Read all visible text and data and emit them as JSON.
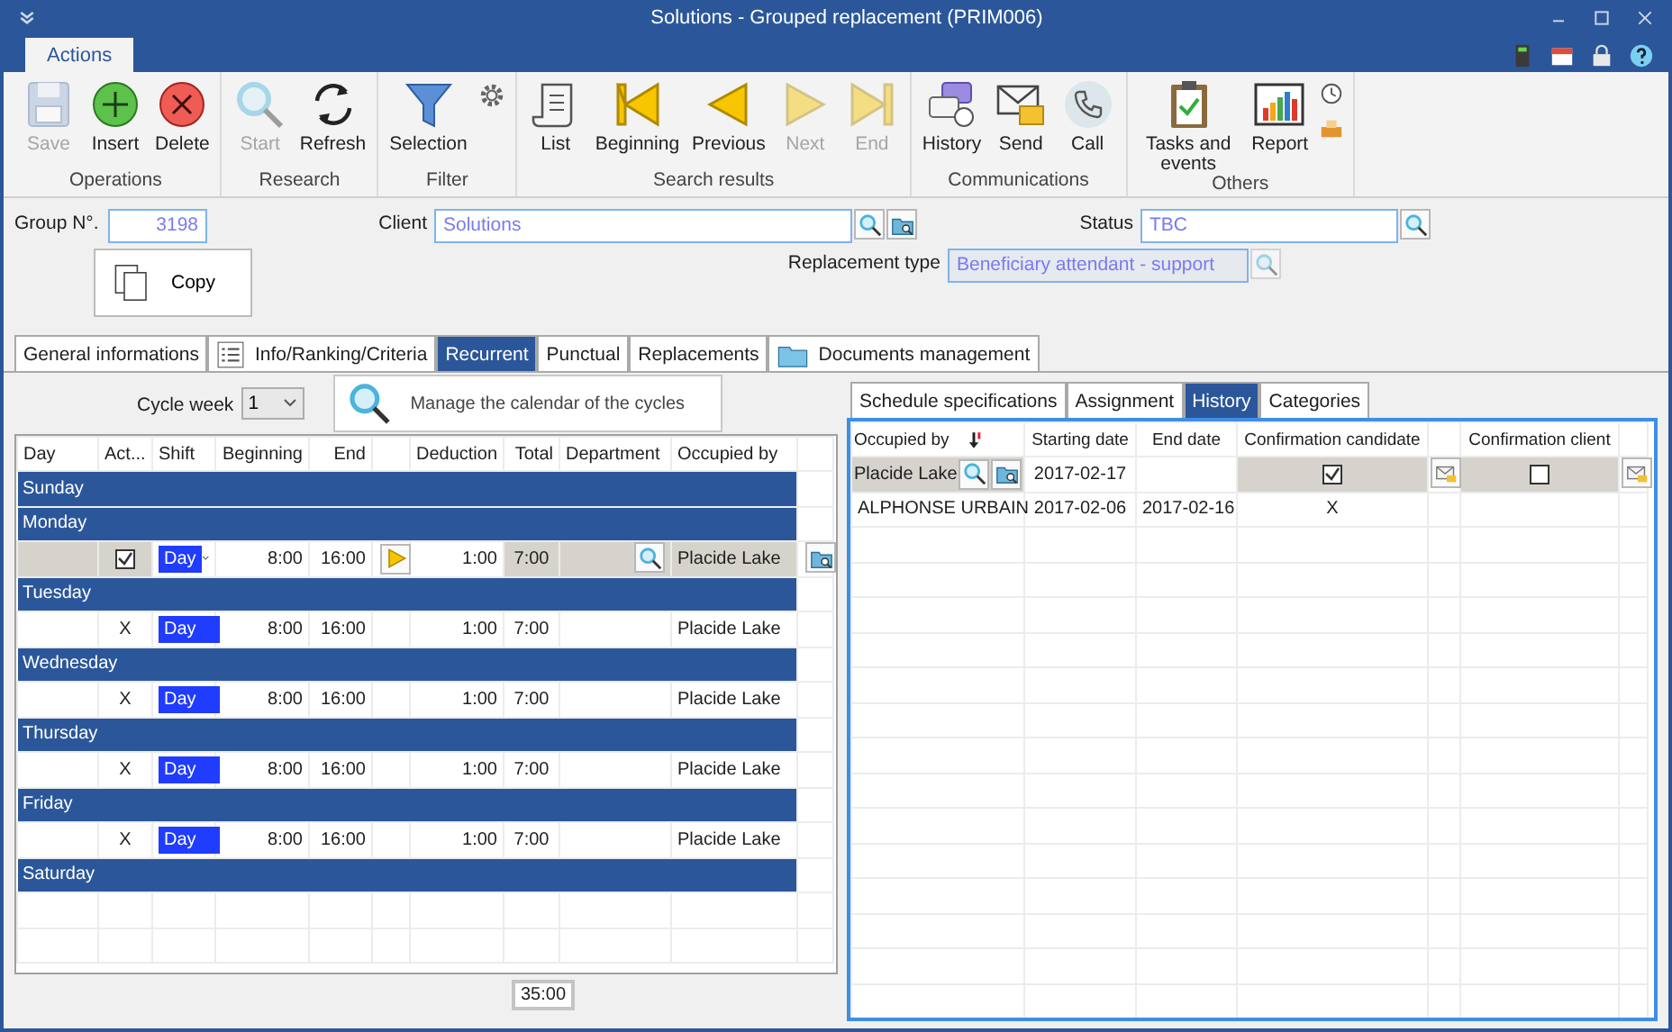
{
  "window": {
    "title": "Solutions - Grouped replacement (PRIM006)"
  },
  "ribbon": {
    "tabs": [
      {
        "label": "Actions",
        "selected": true
      }
    ],
    "groups": [
      {
        "label": "Operations",
        "buttons": [
          {
            "label": "Save",
            "disabled": true
          },
          {
            "label": "Insert",
            "disabled": false
          },
          {
            "label": "Delete",
            "disabled": false
          }
        ]
      },
      {
        "label": "Research",
        "buttons": [
          {
            "label": "Start",
            "disabled": true
          },
          {
            "label": "Refresh",
            "disabled": false
          }
        ]
      },
      {
        "label": "Filter",
        "buttons": [
          {
            "label": "Selection",
            "disabled": false
          }
        ]
      },
      {
        "label": "Search results",
        "buttons": [
          {
            "label": "List",
            "disabled": false
          },
          {
            "label": "Beginning",
            "disabled": false
          },
          {
            "label": "Previous",
            "disabled": false
          },
          {
            "label": "Next",
            "disabled": true
          },
          {
            "label": "End",
            "disabled": true
          }
        ]
      },
      {
        "label": "Communications",
        "buttons": [
          {
            "label": "History",
            "disabled": false
          },
          {
            "label": "Send",
            "disabled": false
          },
          {
            "label": "Call",
            "disabled": false
          }
        ]
      },
      {
        "label": "Others",
        "buttons": [
          {
            "label": "Tasks and events",
            "disabled": false
          },
          {
            "label": "Report",
            "disabled": false
          }
        ]
      }
    ]
  },
  "form": {
    "group_number": {
      "label": "Group N°.",
      "value": "3198"
    },
    "client": {
      "label": "Client",
      "value": "Solutions"
    },
    "status": {
      "label": "Status",
      "value": "TBC"
    },
    "replacement_type": {
      "label": "Replacement type",
      "value": "Beneficiary attendant - support",
      "disabled": true
    },
    "copy_button": "Copy"
  },
  "tabs": [
    {
      "label": "General informations",
      "selected": false
    },
    {
      "label": "Info/Ranking/Criteria",
      "selected": false
    },
    {
      "label": "Recurrent",
      "selected": true
    },
    {
      "label": "Punctual",
      "selected": false
    },
    {
      "label": "Replacements",
      "selected": false
    },
    {
      "label": "Documents management",
      "selected": false
    }
  ],
  "recurrent": {
    "cycle_week": {
      "label": "Cycle week",
      "value": "1"
    },
    "manage_button": "Manage the calendar of the cycles",
    "columns": [
      "Day",
      "Act...",
      "Shift",
      "Beginning",
      "End",
      "Deduction",
      "Total",
      "Department",
      "Occupied by"
    ],
    "rows": [
      {
        "kind": "day",
        "label": "Sunday"
      },
      {
        "kind": "day",
        "label": "Monday"
      },
      {
        "kind": "edit",
        "checked": true,
        "shift": "Day",
        "beginning": "8:00",
        "end": "16:00",
        "deduction": "1:00",
        "total": "7:00",
        "occupied_by": "Placide Lake"
      },
      {
        "kind": "day",
        "label": "Tuesday"
      },
      {
        "kind": "shift",
        "active": "X",
        "shift": "Day",
        "beginning": "8:00",
        "end": "16:00",
        "deduction": "1:00",
        "total": "7:00",
        "occupied_by": "Placide Lake"
      },
      {
        "kind": "day",
        "label": "Wednesday"
      },
      {
        "kind": "shift",
        "active": "X",
        "shift": "Day",
        "beginning": "8:00",
        "end": "16:00",
        "deduction": "1:00",
        "total": "7:00",
        "occupied_by": "Placide Lake"
      },
      {
        "kind": "day",
        "label": "Thursday"
      },
      {
        "kind": "shift",
        "active": "X",
        "shift": "Day",
        "beginning": "8:00",
        "end": "16:00",
        "deduction": "1:00",
        "total": "7:00",
        "occupied_by": "Placide Lake"
      },
      {
        "kind": "day",
        "label": "Friday"
      },
      {
        "kind": "shift",
        "active": "X",
        "shift": "Day",
        "beginning": "8:00",
        "end": "16:00",
        "deduction": "1:00",
        "total": "7:00",
        "occupied_by": "Placide Lake"
      },
      {
        "kind": "day",
        "label": "Saturday"
      }
    ],
    "total": "35:00"
  },
  "history": {
    "tabs": [
      {
        "label": "Schedule specifications",
        "selected": false
      },
      {
        "label": "Assignment",
        "selected": false
      },
      {
        "label": "History",
        "selected": true
      },
      {
        "label": "Categories",
        "selected": false
      }
    ],
    "columns": [
      "Occupied by",
      "Starting date",
      "End date",
      "Confirmation candidate",
      "Confirmation client"
    ],
    "rows": [
      {
        "kind": "edit",
        "occupied_by": "Placide Lake",
        "starting_date": "2017-02-17",
        "candidate_checked": true,
        "client_checked": false
      },
      {
        "kind": "plain",
        "occupied_by": "ALPHONSE URBAIN",
        "starting_date": "2017-02-06",
        "end_date": "2017-02-16",
        "candidate": "X"
      }
    ]
  }
}
